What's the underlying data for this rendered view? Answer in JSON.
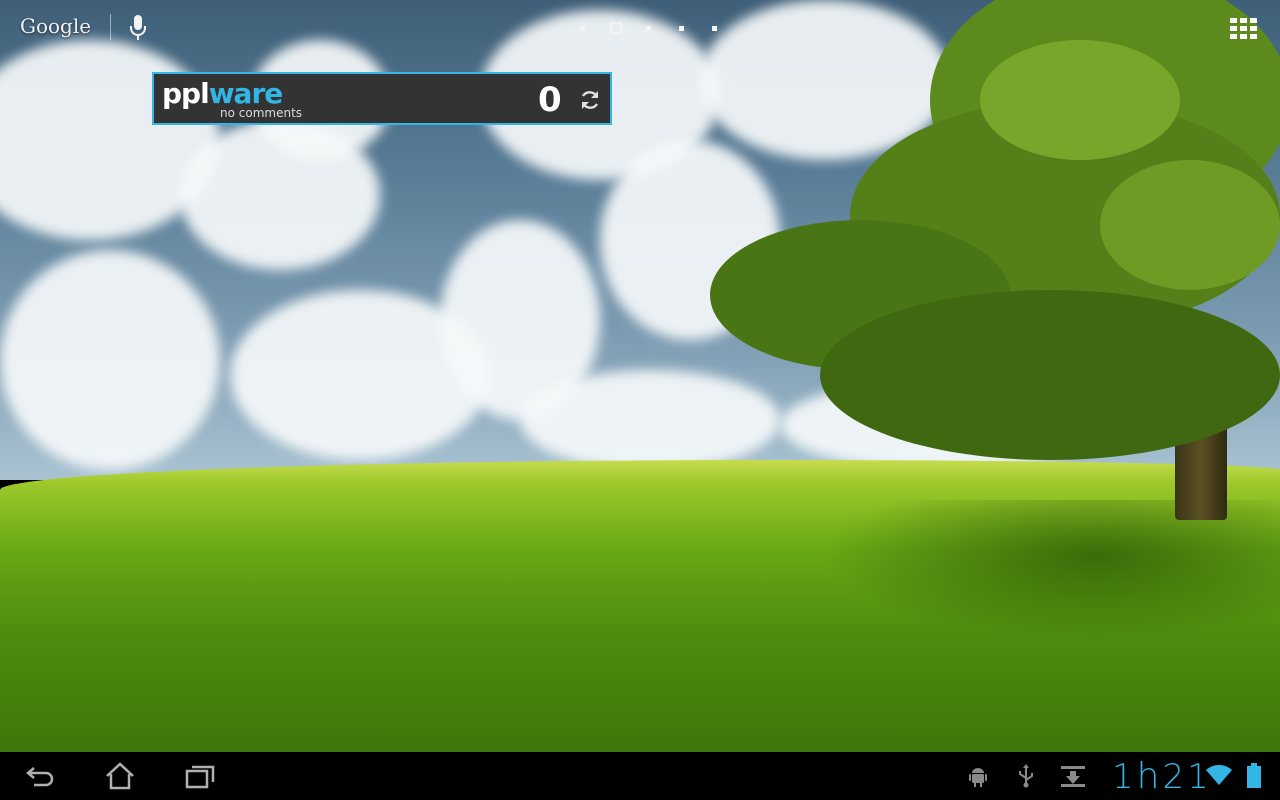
{
  "topbar": {
    "google_label": "Google"
  },
  "page_indicator": {
    "count": 5,
    "active_index": 1
  },
  "widget": {
    "logo_primary": "ppl",
    "logo_accent": "ware",
    "subtitle": "no comments",
    "comment_count": "0",
    "accent_color": "#33b5e5"
  },
  "statusbar": {
    "clock_hour": "1",
    "clock_h": "h",
    "clock_minutes": "21"
  },
  "icons": {
    "mic": "microphone-icon",
    "apps": "apps-grid-icon",
    "refresh": "refresh-icon",
    "back": "back-icon",
    "home": "home-icon",
    "recents": "recent-apps-icon",
    "android": "android-debug-icon",
    "usb": "usb-icon",
    "download": "download-icon",
    "wifi": "wifi-icon",
    "battery": "battery-icon"
  }
}
